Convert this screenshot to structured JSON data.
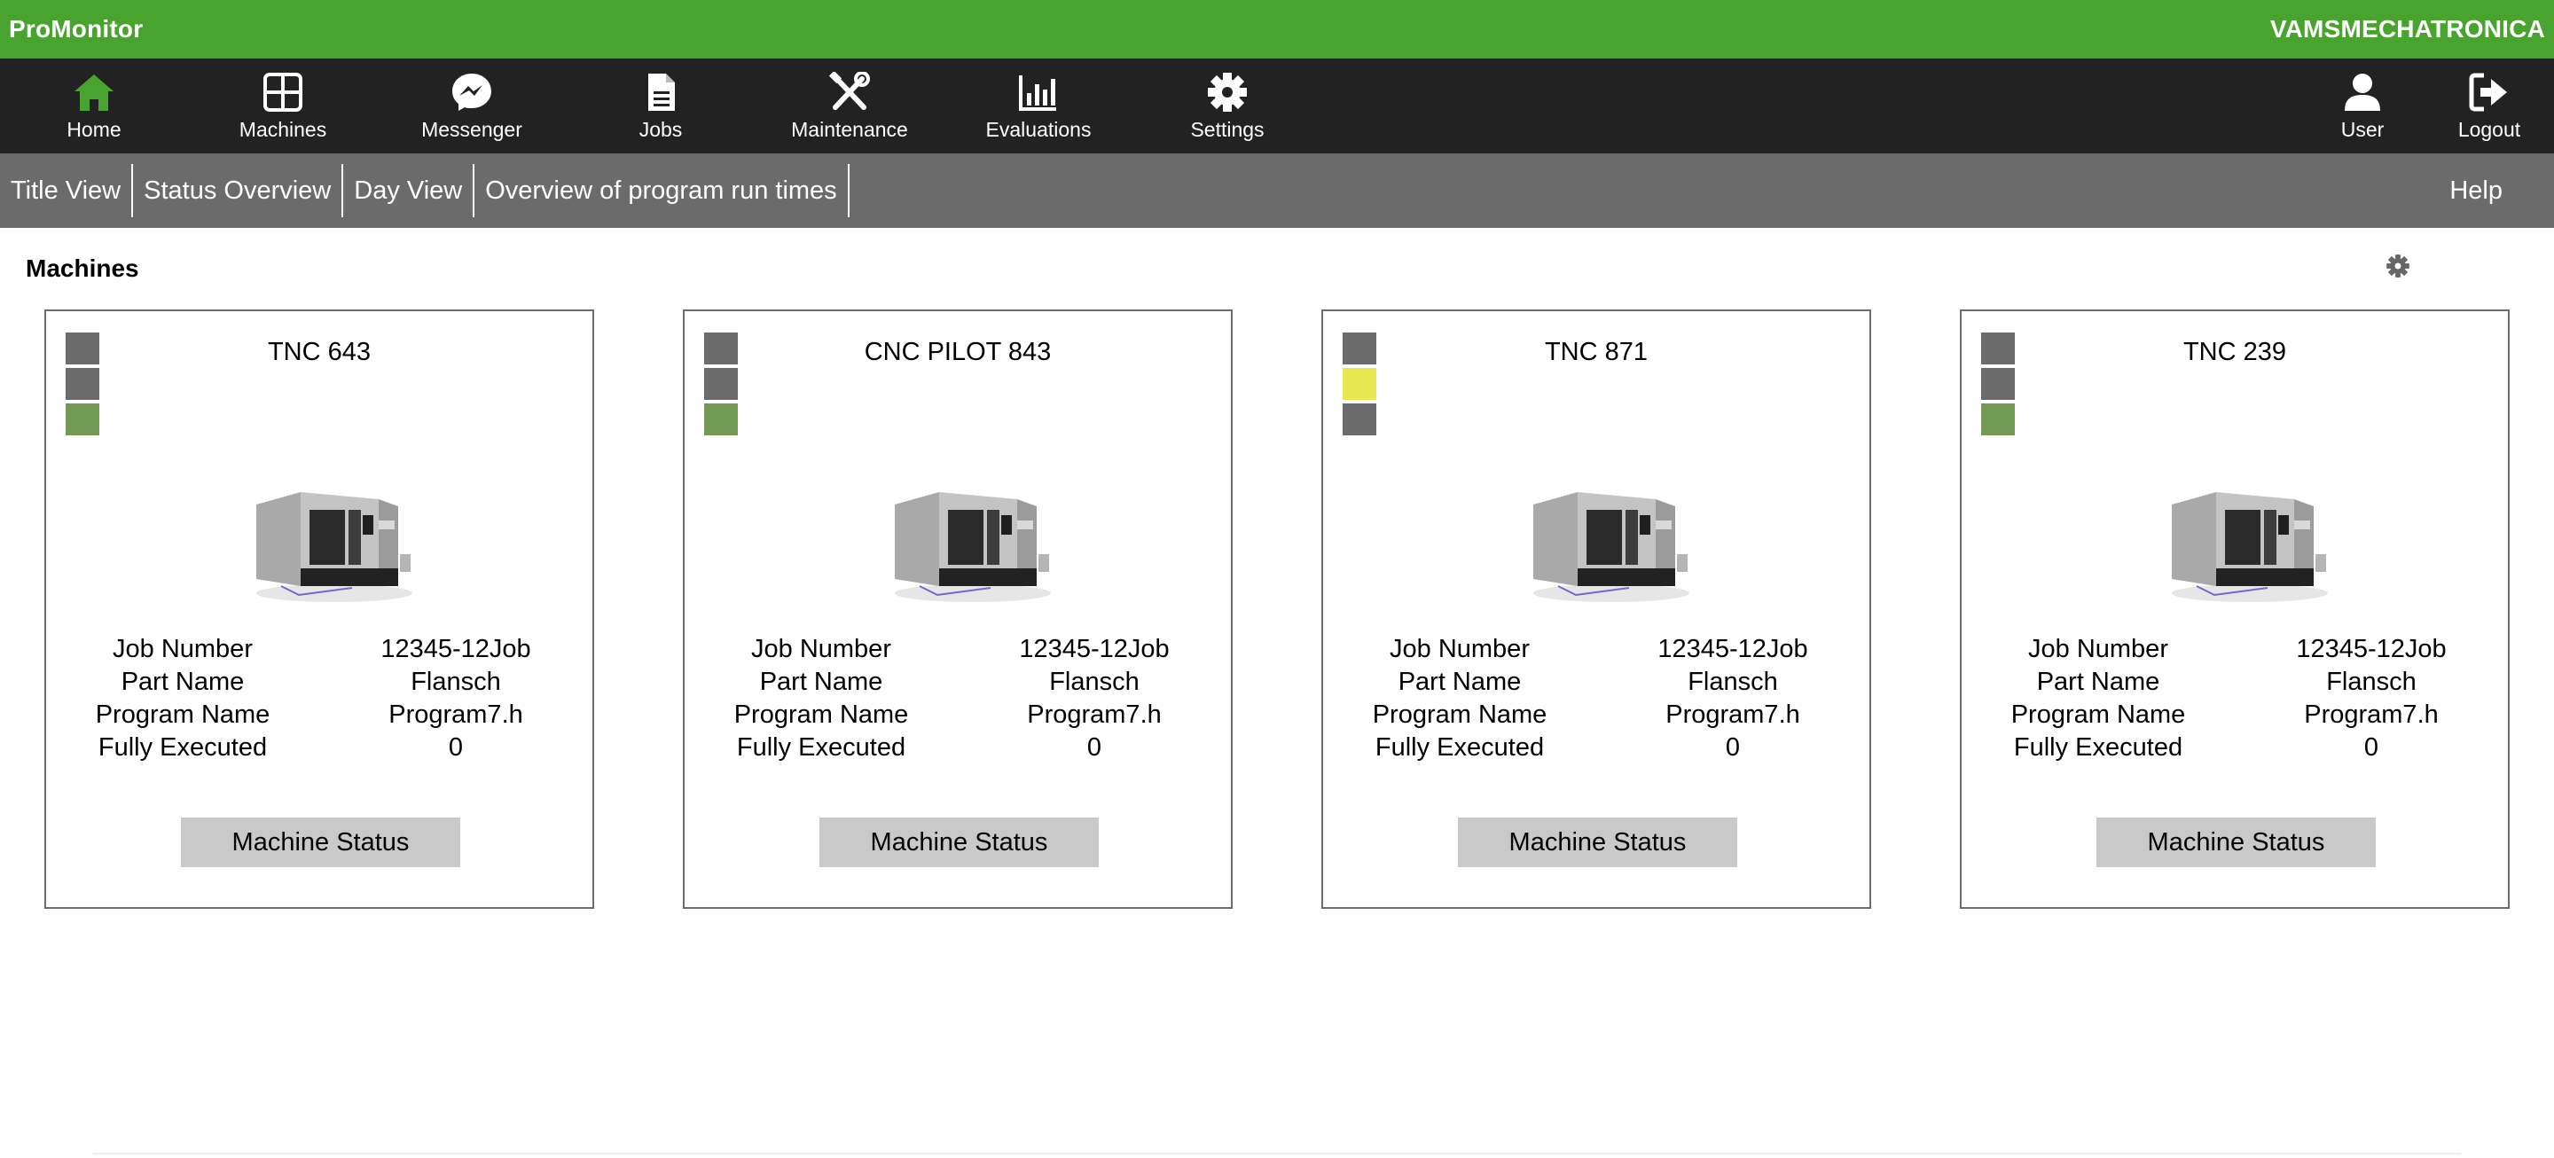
{
  "topbar": {
    "brand": "ProMonitor",
    "company": "VAMSMECHATRONICA"
  },
  "nav": [
    {
      "label": "Home",
      "icon": "home-icon",
      "active": true
    },
    {
      "label": "Machines",
      "icon": "grid-icon"
    },
    {
      "label": "Messenger",
      "icon": "messenger-icon"
    },
    {
      "label": "Jobs",
      "icon": "document-icon"
    },
    {
      "label": "Maintenance",
      "icon": "tools-icon"
    },
    {
      "label": "Evaluations",
      "icon": "bar-chart-icon"
    },
    {
      "label": "Settings",
      "icon": "gear-icon"
    }
  ],
  "nav_right": [
    {
      "label": "User",
      "icon": "user-icon"
    },
    {
      "label": "Logout",
      "icon": "logout-icon"
    }
  ],
  "subnav": {
    "tabs": [
      "Title View",
      "Status Overview",
      "Day View",
      "Overview of program run times"
    ],
    "help": "Help"
  },
  "section": {
    "title": "Machines"
  },
  "colors": {
    "topbar": "#49a32f",
    "navbar": "#222222",
    "subnav": "#6b6b6b",
    "led_off": "#6b6b6b",
    "led_green": "#739a55",
    "led_yellow": "#e9e653",
    "home_active": "#49a32f"
  },
  "cards": [
    {
      "title": "TNC 643",
      "leds": [
        "off",
        "off",
        "green"
      ],
      "fields": [
        {
          "label": "Job Number",
          "value": "12345-12Job"
        },
        {
          "label": "Part Name",
          "value": "Flansch"
        },
        {
          "label": "Program Name",
          "value": "Program7.h"
        },
        {
          "label": "Fully Executed",
          "value": "0"
        }
      ],
      "button": "Machine Status"
    },
    {
      "title": "CNC PILOT 843",
      "leds": [
        "off",
        "off",
        "green"
      ],
      "fields": [
        {
          "label": "Job Number",
          "value": "12345-12Job"
        },
        {
          "label": "Part Name",
          "value": "Flansch"
        },
        {
          "label": "Program Name",
          "value": "Program7.h"
        },
        {
          "label": "Fully Executed",
          "value": "0"
        }
      ],
      "button": "Machine Status"
    },
    {
      "title": "TNC 871",
      "leds": [
        "off",
        "yellow",
        "off"
      ],
      "fields": [
        {
          "label": "Job Number",
          "value": "12345-12Job"
        },
        {
          "label": "Part Name",
          "value": "Flansch"
        },
        {
          "label": "Program Name",
          "value": "Program7.h"
        },
        {
          "label": "Fully Executed",
          "value": "0"
        }
      ],
      "button": "Machine Status"
    },
    {
      "title": "TNC 239",
      "leds": [
        "off",
        "off",
        "green"
      ],
      "fields": [
        {
          "label": "Job Number",
          "value": "12345-12Job"
        },
        {
          "label": "Part Name",
          "value": "Flansch"
        },
        {
          "label": "Program Name",
          "value": "Program7.h"
        },
        {
          "label": "Fully Executed",
          "value": "0"
        }
      ],
      "button": "Machine Status"
    }
  ]
}
